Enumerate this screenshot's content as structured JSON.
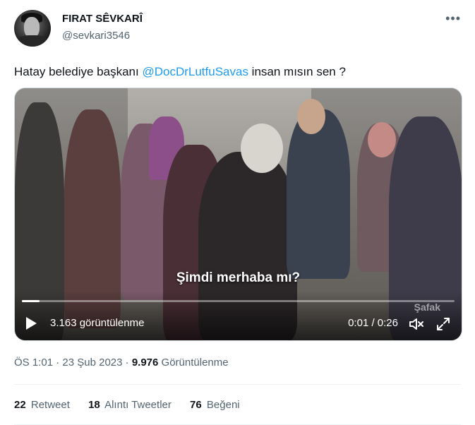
{
  "author": {
    "name": "FIRAT SÊVKARÎ",
    "handle": "@sevkari3546"
  },
  "tweet": {
    "text_before": "Hatay belediye başkanı ",
    "mention": "@DocDrLutfuSavas",
    "text_after": " insan mısın sen ?"
  },
  "video": {
    "caption": "Şimdi merhaba mı?",
    "watermark": "Şafak",
    "views_label": "3.163 görüntülenme",
    "time": "0:01 / 0:26",
    "progress": 0.04
  },
  "meta": {
    "time": "ÖS 1:01",
    "separator1": " · ",
    "date": "23 Şub 2023",
    "separator2": " · ",
    "views_count": "9.976",
    "views_label": "Görüntülenme"
  },
  "stats": {
    "retweets_count": "22",
    "retweets_label": "Retweet",
    "quotes_count": "18",
    "quotes_label": "Alıntı Tweetler",
    "likes_count": "76",
    "likes_label": "Beğeni"
  },
  "icons": {
    "more": "more-icon",
    "play": "play-icon",
    "mute": "mute-icon",
    "fullscreen": "fullscreen-icon"
  },
  "colors": {
    "accent": "#1d9bf0",
    "text": "#0f1419",
    "secondary": "#536471"
  }
}
